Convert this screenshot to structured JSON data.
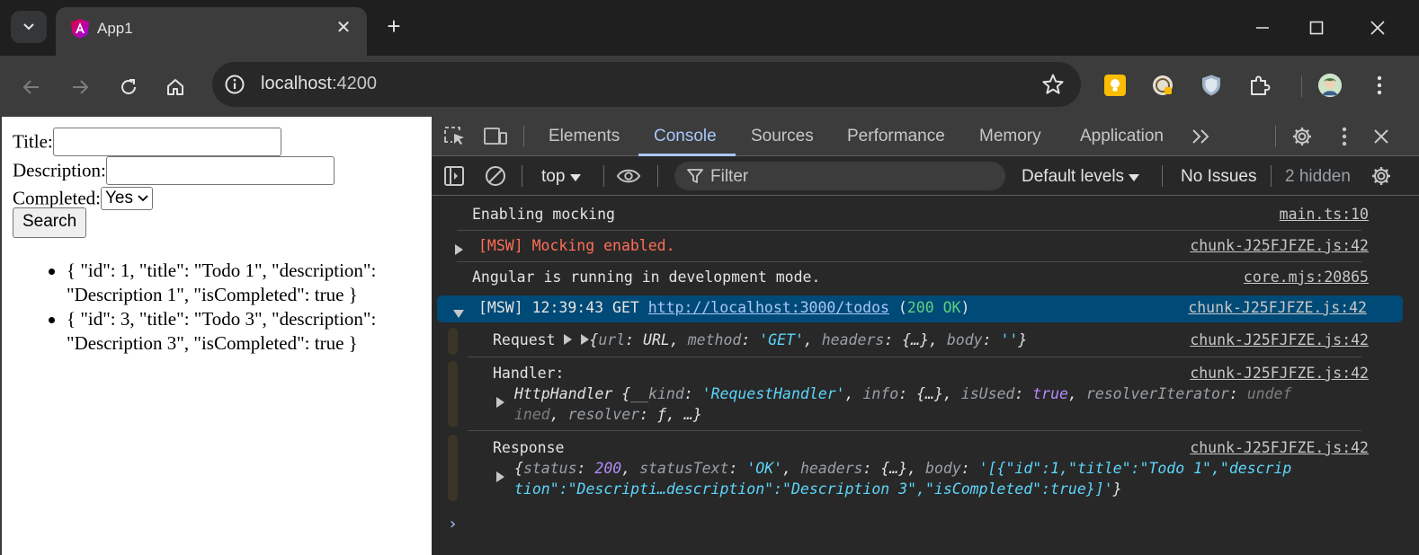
{
  "browser": {
    "tab_title": "App1",
    "url_host": "localhost",
    "url_port": ":4200",
    "accent": "#a8c7fa"
  },
  "page": {
    "title_label": "Title:",
    "title_value": "",
    "description_label": "Description:",
    "description_value": "",
    "completed_label": "Completed:",
    "completed_selected": "Yes",
    "search_button": "Search",
    "results": [
      "{ \"id\": 1, \"title\": \"Todo 1\", \"description\": \"Description 1\", \"isCompleted\": true }",
      "{ \"id\": 3, \"title\": \"Todo 3\", \"description\": \"Description 3\", \"isCompleted\": true }"
    ]
  },
  "devtools": {
    "tabs": [
      "Elements",
      "Console",
      "Sources",
      "Performance",
      "Memory",
      "Application"
    ],
    "active_tab": "Console",
    "context": "top",
    "filter_placeholder": "Filter",
    "levels": "Default levels",
    "issues": "No Issues",
    "hidden": "2 hidden",
    "messages": [
      {
        "text": "Enabling mocking",
        "source": "main.ts:10"
      },
      {
        "text": "[MSW] Mocking enabled.",
        "source": "chunk-J25FJFZE.js:42",
        "color": "#ff6e57"
      },
      {
        "text": "Angular is running in development mode.",
        "source": "core.mjs:20865"
      },
      {
        "prefix": "[MSW] 12:39:43 GET ",
        "link": "http://localhost:3000/todos",
        "status_open": " (",
        "status_code": "200",
        "status_text": "OK",
        "status_close": ")",
        "source": "chunk-J25FJFZE.js:42"
      }
    ],
    "group": {
      "request_label": "Request",
      "request_source": "chunk-J25FJFZE.js:42",
      "handler_label": "Handler:",
      "handler_source": "chunk-J25FJFZE.js:42",
      "handler_class": "HttpHandler",
      "handler_kind": "'RequestHandler'",
      "handler_isused": "true",
      "handler_iter_a": "undef",
      "handler_iter_b": "ined",
      "response_label": "Response",
      "response_source": "chunk-J25FJFZE.js:42",
      "response_status": "200",
      "response_status_text": "'OK'",
      "response_body_a": "'[{\"id\":1,\"title\":\"Todo 1\",\"descrip",
      "response_body_b": "tion\":\"Descripti…description\":\"Description 3\",\"isCompleted\":true}]'"
    }
  }
}
